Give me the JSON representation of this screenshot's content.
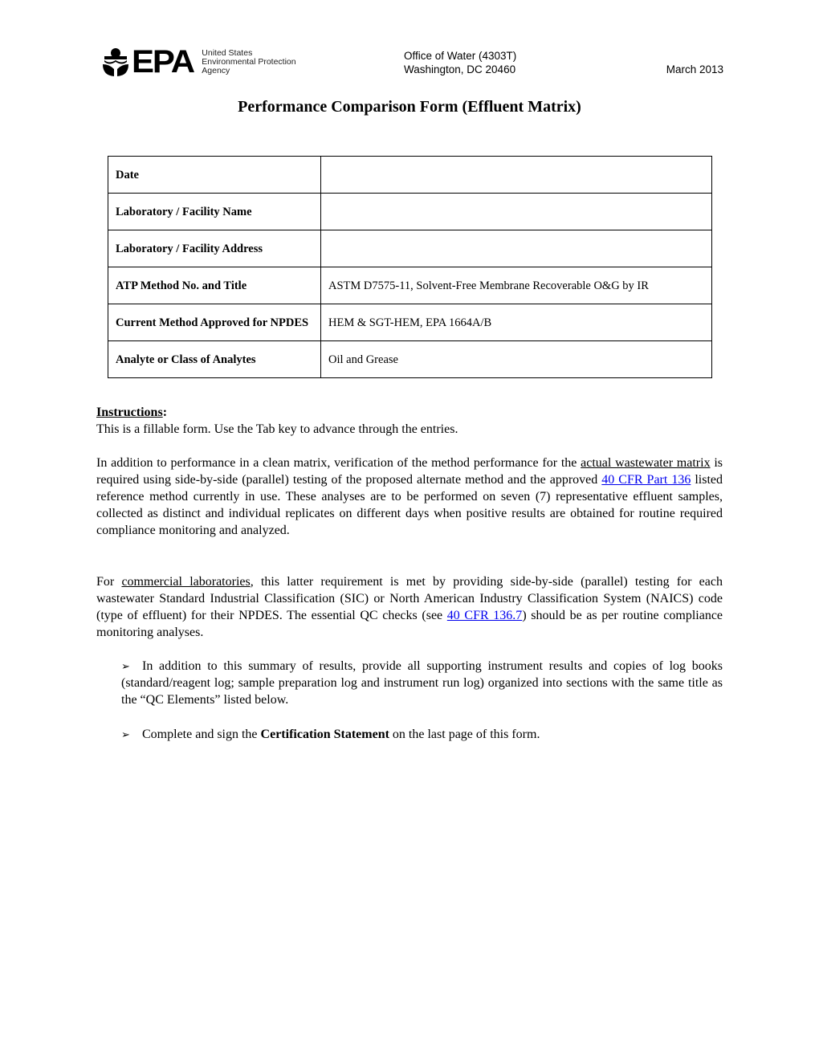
{
  "header": {
    "logo_text": "EPA",
    "agency_lines": [
      "United States",
      "Environmental Protection",
      "Agency"
    ],
    "office_lines": [
      "Office of Water (4303T)",
      "Washington, DC 20460"
    ],
    "date": "March 2013"
  },
  "title": "Performance Comparison Form (Effluent Matrix)",
  "info_table": {
    "rows": [
      {
        "label": "Date",
        "value": ""
      },
      {
        "label": "Laboratory / Facility Name",
        "value": ""
      },
      {
        "label": "Laboratory / Facility Address",
        "value": ""
      },
      {
        "label": "ATP Method No. and Title",
        "value": "ASTM D7575-11, Solvent-Free Membrane Recoverable O&G by IR"
      },
      {
        "label": "Current Method Approved for NPDES",
        "value": "HEM & SGT-HEM, EPA 1664A/B"
      },
      {
        "label": "Analyte or Class of Analytes",
        "value": "Oil and Grease"
      }
    ]
  },
  "instructions": {
    "heading": "Instructions",
    "heading_colon": ":",
    "intro": "This is a fillable form. Use the Tab key to advance through the entries.",
    "para1": {
      "t1": "In addition to performance in a clean matrix, verification of the method performance for the ",
      "u1": "actual wastewater matrix",
      "t2": " is required using side-by-side (parallel) testing of the proposed alternate method and the approved ",
      "link1": "40 CFR Part 136",
      "t3": " listed reference method currently in use.  These analyses are to be performed on seven (7) representative effluent samples, collected as distinct and individual replicates on different days when positive results are obtained for routine required compliance monitoring and analyzed."
    },
    "para2": {
      "t1": "For ",
      "u1": "commercial laboratories",
      "t2": ", this latter requirement is met by providing side-by-side (parallel) testing for each wastewater Standard Industrial Classification (SIC) or North American Industry Classification System (NAICS) code (type of effluent) for their NPDES.  The essential QC checks (see ",
      "link1": "40 CFR 136.7",
      "t3": ") should be as per routine compliance monitoring analyses."
    },
    "bullets": [
      {
        "text": "In addition to this summary of results, provide all supporting instrument results and copies of log books (standard/reagent log; sample preparation log and instrument run log) organized into sections with the same title as the “QC Elements” listed below."
      },
      {
        "pre": "Complete and sign the ",
        "bold": "Certification Statement",
        "post": " on the last page of this form."
      }
    ],
    "bullet_glyph": "➢"
  }
}
